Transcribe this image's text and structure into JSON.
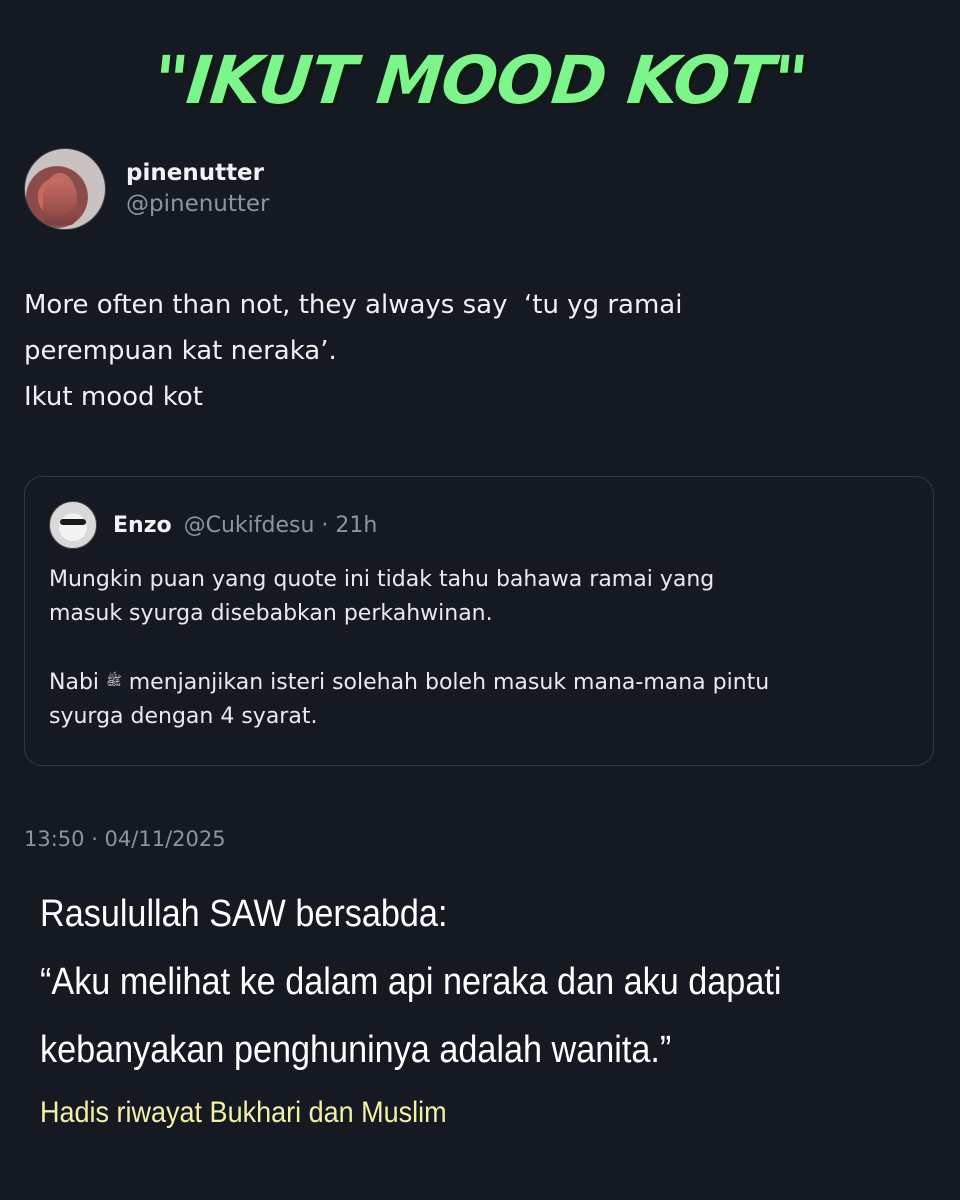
{
  "headline": "\"IKUT MOOD KOT\"",
  "post": {
    "display_name": "pinenutter",
    "handle": "@pinenutter",
    "text_lines": [
      "More often than not, they always say  ‘tu yg ramai",
      "perempuan kat neraka’.",
      "Ikut mood kot"
    ],
    "timestamp": "13:50 · 04/11/2025"
  },
  "quoted_post": {
    "display_name": "Enzo",
    "meta": "@Cukifdesu · 21h",
    "para1_lines": [
      "Mungkin puan yang quote ini tidak tahu bahawa ramai yang",
      "masuk syurga disebabkan perkahwinan."
    ],
    "para2_prefix": "Nabi",
    "para2_glyph": "ﷺ",
    "para2_line1_rest": "menjanjikan isteri solehah boleh masuk mana-mana pintu",
    "para2_line2": "syurga dengan 4 syarat."
  },
  "overlay": {
    "hadith_lines": [
      "Rasulullah SAW bersabda:",
      "“Aku melihat ke dalam api neraka dan aku dapati",
      "kebanyakan penghuninya adalah wanita.”"
    ],
    "source": "Hadis riwayat Bukhari dan Muslim"
  },
  "colors": {
    "background": "#151a22",
    "headline": "#7cf58a",
    "muted": "#8b95a1",
    "source": "#f4efa6"
  }
}
